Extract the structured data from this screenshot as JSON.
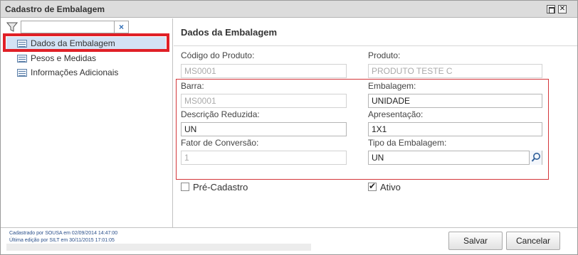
{
  "window": {
    "title": "Cadastro de Embalagem"
  },
  "sidebar": {
    "filter": {
      "value": "",
      "clear_label": "×"
    },
    "items": [
      {
        "label": "Dados da Embalagem",
        "selected": true
      },
      {
        "label": "Pesos e Medidas"
      },
      {
        "label": "Informações Adicionais"
      }
    ]
  },
  "form": {
    "section_title": "Dados da Embalagem",
    "codigo_produto": {
      "label": "Código do Produto:",
      "value": "MS0001"
    },
    "produto": {
      "label": "Produto:",
      "value": "PRODUTO TESTE C"
    },
    "barra": {
      "label": "Barra:",
      "value": "MS0001"
    },
    "embalagem": {
      "label": "Embalagem:",
      "value": "UNIDADE"
    },
    "descricao_reduzida": {
      "label": "Descrição Reduzida:",
      "value": "UN"
    },
    "apresentacao": {
      "label": "Apresentação:",
      "value": "1X1"
    },
    "fator_conversao": {
      "label": "Fator de Conversão:",
      "value": "1"
    },
    "tipo_embalagem": {
      "label": "Tipo da Embalagem:",
      "value": "UN"
    },
    "pre_cadastro": {
      "label": "Pré-Cadastro",
      "checked": false
    },
    "ativo": {
      "label": "Ativo",
      "checked": true
    }
  },
  "footer": {
    "cadastrado": "Cadastrado por SOUSA em 02/09/2014 14:47:00",
    "ultima_edicao": "Última edição por SILT em 30/11/2015 17:01:05",
    "save_label": "Salvar",
    "cancel_label": "Cancelar"
  },
  "colors": {
    "highlight_border": "#e02027",
    "selected_bg": "#d3e2f5",
    "group_border": "#d4363a"
  }
}
